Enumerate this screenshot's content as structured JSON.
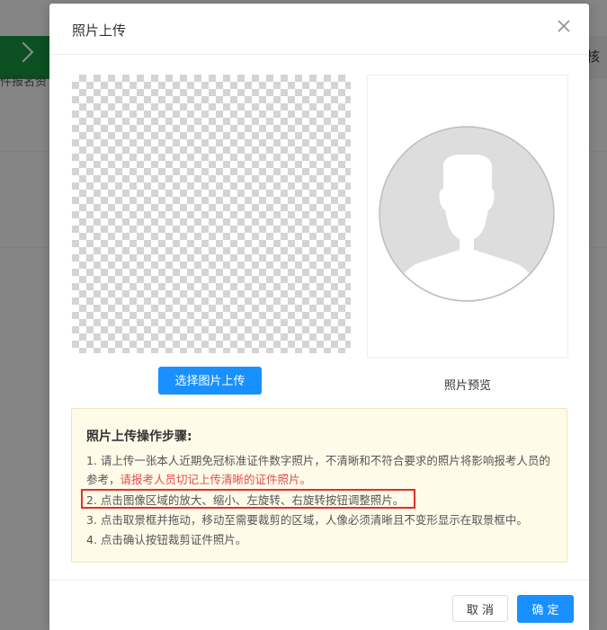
{
  "background": {
    "step_left_text": "件报名资",
    "step_right_text": "核"
  },
  "modal": {
    "title": "照片上传",
    "select_button": "选择图片上传",
    "preview_label": "照片预览",
    "instructions": {
      "title": "照片上传操作步骤:",
      "item1_prefix": "1. 请上传一张本人近期免冠标准证件数字照片，不清晰和不符合要求的照片将影响报考人员的参考，",
      "item1_warning": "请报考人员切记上传清晰的证件照片。",
      "item2": "2. 点击图像区域的放大、缩小、左旋转、右旋转按钮调整照片。",
      "item3": "3. 点击取景框并拖动，移动至需要裁剪的区域，人像必须清晰且不变形显示在取景框中。",
      "item4": "4. 点击确认按钮裁剪证件照片。"
    },
    "cancel_button": "取 消",
    "ok_button": "确 定"
  },
  "colors": {
    "primary": "#1890ff",
    "warning_text": "#e04e4e",
    "highlight_border": "#e22f2f",
    "notice_bg": "#fffbe9",
    "step_green": "#17923e"
  },
  "icons": [
    "close-icon",
    "avatar-placeholder-icon",
    "chevron-right-icon"
  ]
}
